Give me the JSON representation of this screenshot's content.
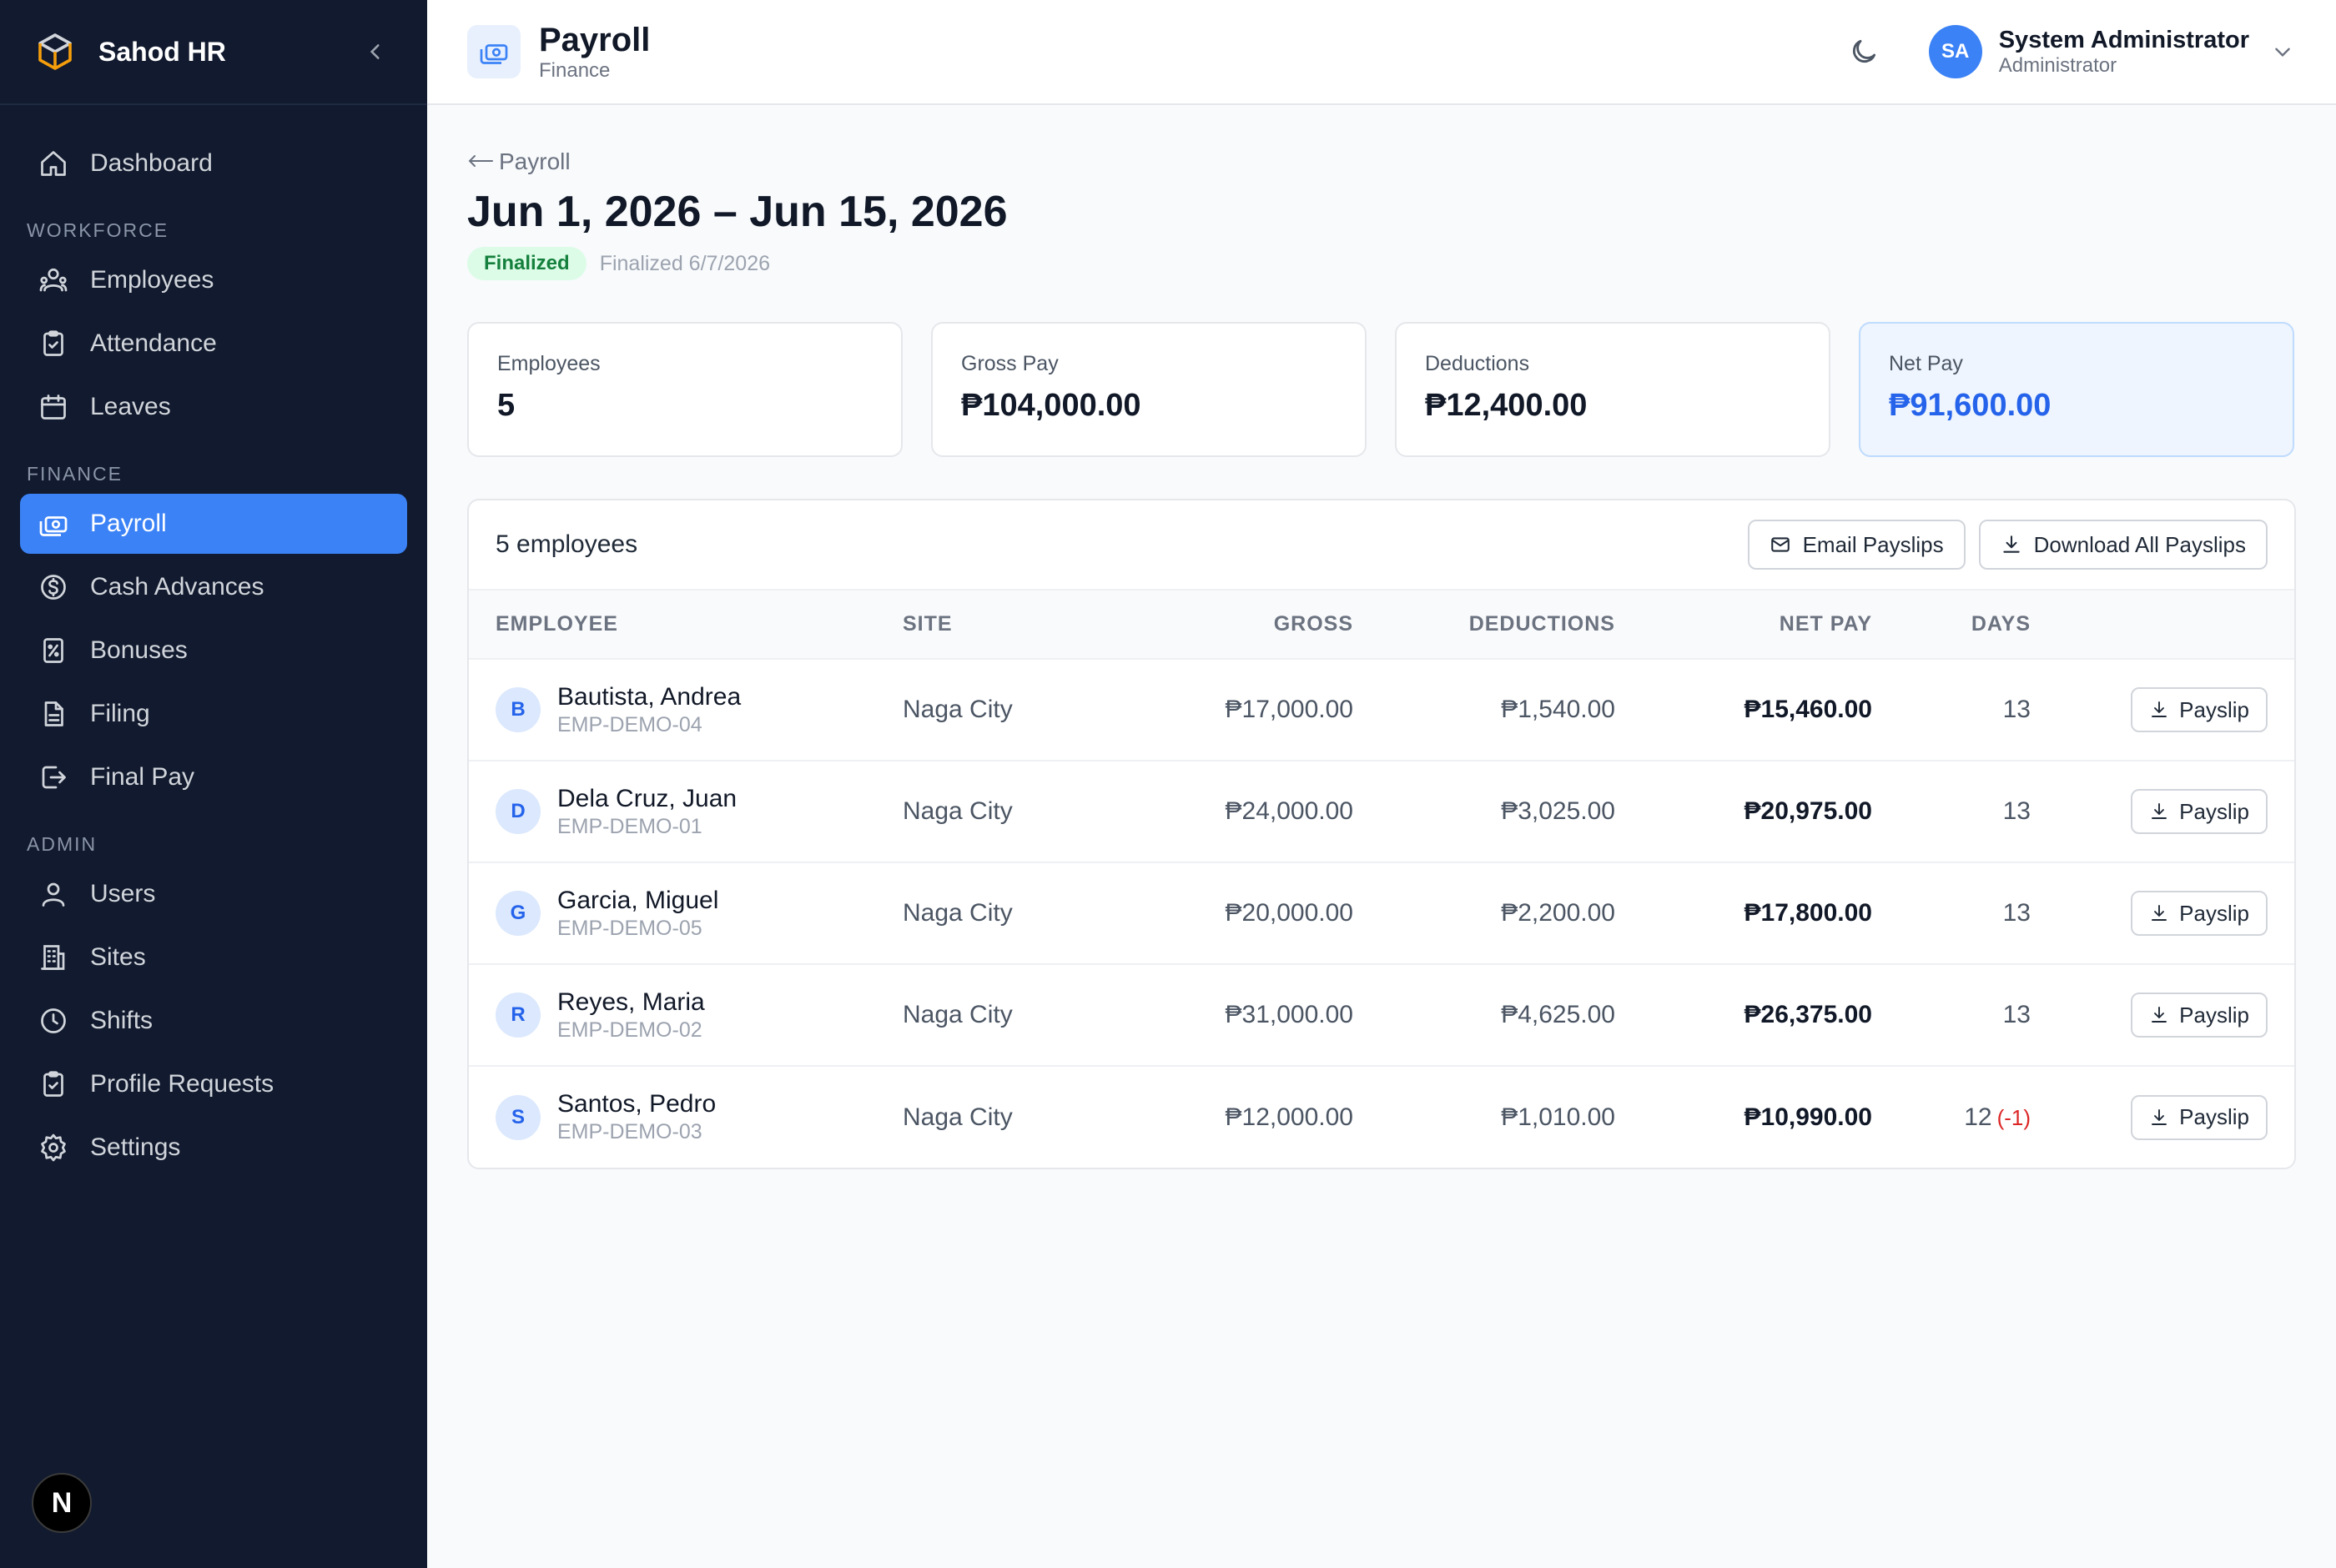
{
  "sidebar": {
    "brand": "Sahod HR",
    "dashboard": "Dashboard",
    "sections": {
      "workforce": "WORKFORCE",
      "finance": "FINANCE",
      "admin": "ADMIN"
    },
    "items": {
      "employees": "Employees",
      "attendance": "Attendance",
      "leaves": "Leaves",
      "payroll": "Payroll",
      "cash_advances": "Cash Advances",
      "bonuses": "Bonuses",
      "filing": "Filing",
      "final_pay": "Final Pay",
      "users": "Users",
      "sites": "Sites",
      "shifts": "Shifts",
      "profile_requests": "Profile Requests",
      "settings": "Settings"
    },
    "active": "payroll",
    "badge": "N"
  },
  "header": {
    "title": "Payroll",
    "subtitle": "Finance",
    "user": {
      "initials": "SA",
      "name": "System Administrator",
      "role": "Administrator"
    }
  },
  "page": {
    "back_label": "Payroll",
    "period": "Jun 1, 2026 – Jun 15, 2026",
    "status": "Finalized",
    "finalized_date": "Finalized 6/7/2026"
  },
  "summary": {
    "employees": {
      "label": "Employees",
      "value": "5"
    },
    "gross": {
      "label": "Gross Pay",
      "value": "₱104,000.00"
    },
    "deductions": {
      "label": "Deductions",
      "value": "₱12,400.00"
    },
    "net": {
      "label": "Net Pay",
      "value": "₱91,600.00"
    }
  },
  "table": {
    "count_label": "5 employees",
    "email_btn": "Email Payslips",
    "download_btn": "Download All Payslips",
    "headers": {
      "employee": "EMPLOYEE",
      "site": "SITE",
      "gross": "GROSS",
      "deductions": "DEDUCTIONS",
      "net": "NET PAY",
      "days": "DAYS"
    },
    "payslip_label": "Payslip",
    "rows": [
      {
        "initial": "B",
        "name": "Bautista, Andrea",
        "id": "EMP-DEMO-04",
        "site": "Naga City",
        "gross": "₱17,000.00",
        "deductions": "₱1,540.00",
        "net": "₱15,460.00",
        "days": "13",
        "days_adj": ""
      },
      {
        "initial": "D",
        "name": "Dela Cruz, Juan",
        "id": "EMP-DEMO-01",
        "site": "Naga City",
        "gross": "₱24,000.00",
        "deductions": "₱3,025.00",
        "net": "₱20,975.00",
        "days": "13",
        "days_adj": ""
      },
      {
        "initial": "G",
        "name": "Garcia, Miguel",
        "id": "EMP-DEMO-05",
        "site": "Naga City",
        "gross": "₱20,000.00",
        "deductions": "₱2,200.00",
        "net": "₱17,800.00",
        "days": "13",
        "days_adj": ""
      },
      {
        "initial": "R",
        "name": "Reyes, Maria",
        "id": "EMP-DEMO-02",
        "site": "Naga City",
        "gross": "₱31,000.00",
        "deductions": "₱4,625.00",
        "net": "₱26,375.00",
        "days": "13",
        "days_adj": ""
      },
      {
        "initial": "S",
        "name": "Santos, Pedro",
        "id": "EMP-DEMO-03",
        "site": "Naga City",
        "gross": "₱12,000.00",
        "deductions": "₱1,010.00",
        "net": "₱10,990.00",
        "days": "12",
        "days_adj": "(-1)"
      }
    ]
  },
  "colors": {
    "sidebar_bg": "#111a2e",
    "accent": "#3b82f6",
    "success": "#15803d",
    "negative": "#dc2626"
  }
}
